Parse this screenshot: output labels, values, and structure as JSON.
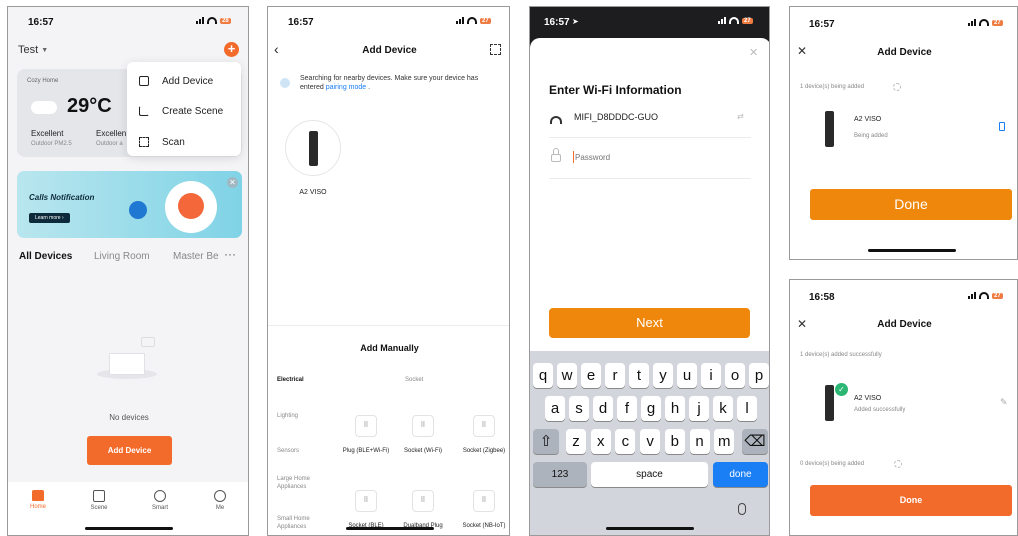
{
  "colors": {
    "accent": "#f36b2b",
    "amber": "#f0870d",
    "blue": "#1a7ef5",
    "green": "#2bb673"
  },
  "screen1": {
    "time": "16:57",
    "battery": "28",
    "home_name": "Test",
    "weather": {
      "location": "Cozy Home",
      "temp": "29°C",
      "air1": "Excellent",
      "air1_sub": "Outdoor PM2.5",
      "air2": "Excellen",
      "air2_sub": "Outdoor a"
    },
    "menu": [
      {
        "label": "Add Device",
        "icon": "device-add-icon"
      },
      {
        "label": "Create Scene",
        "icon": "scene-add-icon"
      },
      {
        "label": "Scan",
        "icon": "scan-icon"
      }
    ],
    "banner": {
      "title": "Calls Notification",
      "button": "Learn more ›"
    },
    "tabs": [
      "All Devices",
      "Living Room",
      "Master Be"
    ],
    "empty_text": "No devices",
    "add_device_button": "Add Device",
    "nav": [
      {
        "label": "Home",
        "icon": "home-icon"
      },
      {
        "label": "Scene",
        "icon": "scene-icon"
      },
      {
        "label": "Smart",
        "icon": "smart-icon"
      },
      {
        "label": "Me",
        "icon": "me-icon"
      }
    ]
  },
  "screen2": {
    "time": "16:57",
    "battery": "27",
    "title": "Add Device",
    "searching_text": "Searching for nearby devices. Make sure your device has entered",
    "pairing_link": "pairing mode",
    "found_device": "A2 VISO",
    "add_manually": "Add Manually",
    "categories": [
      "Electrical",
      "Lighting",
      "Sensors",
      "Large Home Appliances",
      "Small Home Appliances"
    ],
    "section_label": "Socket",
    "grid": [
      {
        "label": "Plug (BLE+Wi-Fi)"
      },
      {
        "label": "Socket (Wi-Fi)"
      },
      {
        "label": "Socket (Zigbee)"
      },
      {
        "label": "Socket (BLE)"
      },
      {
        "label": "Dualband Plug"
      },
      {
        "label": "Socket (NB-IoT)"
      }
    ]
  },
  "screen3": {
    "time": "16:57",
    "battery": "27",
    "title": "Enter Wi-Fi Information",
    "ssid": "MIFI_D8DDDC-GUO",
    "password_placeholder": "Password",
    "next_button": "Next",
    "keyboard": {
      "row1": [
        "q",
        "w",
        "e",
        "r",
        "t",
        "y",
        "u",
        "i",
        "o",
        "p"
      ],
      "row2": [
        "a",
        "s",
        "d",
        "f",
        "g",
        "h",
        "j",
        "k",
        "l"
      ],
      "row3": [
        "z",
        "x",
        "c",
        "v",
        "b",
        "n",
        "m"
      ],
      "numbers": "123",
      "space": "space",
      "done": "done"
    }
  },
  "screen4": {
    "time": "16:57",
    "battery": "27",
    "title": "Add Device",
    "status": "1 device(s) being added",
    "device": "A2 VISO",
    "device_status": "Being added",
    "done_button": "Done"
  },
  "screen5": {
    "time": "16:58",
    "battery": "27",
    "title": "Add Device",
    "status": "1 device(s) added successfully",
    "device": "A2 VISO",
    "device_status": "Added successfully",
    "status2": "0 device(s) being added",
    "done_button": "Done"
  }
}
